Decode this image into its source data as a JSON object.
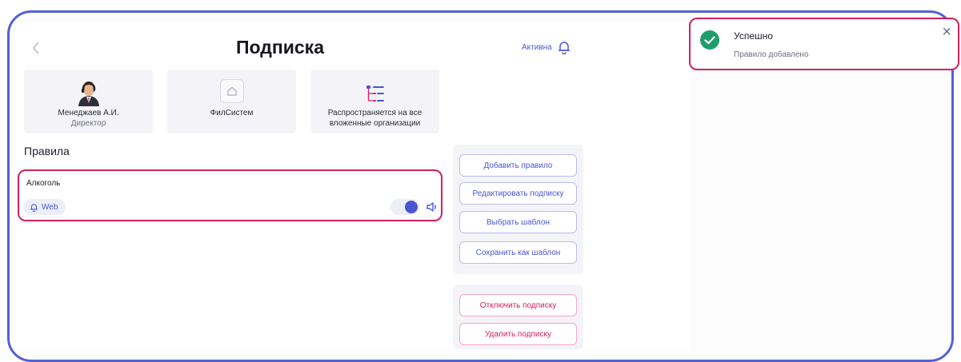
{
  "header": {
    "title": "Подписка",
    "status_label": "Активна"
  },
  "info_cards": [
    {
      "name": "Менеджаев А.И.",
      "subtitle": "Директор"
    },
    {
      "name": "ФилСистем"
    },
    {
      "name": "Распространяется на все вложенные организации"
    }
  ],
  "rules": {
    "heading": "Правила",
    "items": [
      {
        "name": "Алкоголь",
        "channel": "Web",
        "enabled": true
      }
    ]
  },
  "actions": {
    "add_rule": "Добавить правило",
    "edit_subscription": "Редактировать подписку",
    "choose_template": "Выбрать шаблон",
    "save_as_template": "Сохранить как шаблон",
    "disable_subscription": "Отключить подписку",
    "delete_subscription": "Удалить подписку"
  },
  "toast": {
    "title": "Успешно",
    "message": "Правило добавлено",
    "close_symbol": "×"
  },
  "colors": {
    "accent": "#4a55d4",
    "danger": "#d4205f",
    "success": "#1f9d6a",
    "card_bg": "#f4f4f8"
  },
  "icons": {
    "back": "chevron-left-icon",
    "status": "bell-icon",
    "org": "home-icon",
    "scope": "tree-icon",
    "channel": "bell-icon",
    "sound": "speaker-icon",
    "toast": "check-circle-icon"
  }
}
